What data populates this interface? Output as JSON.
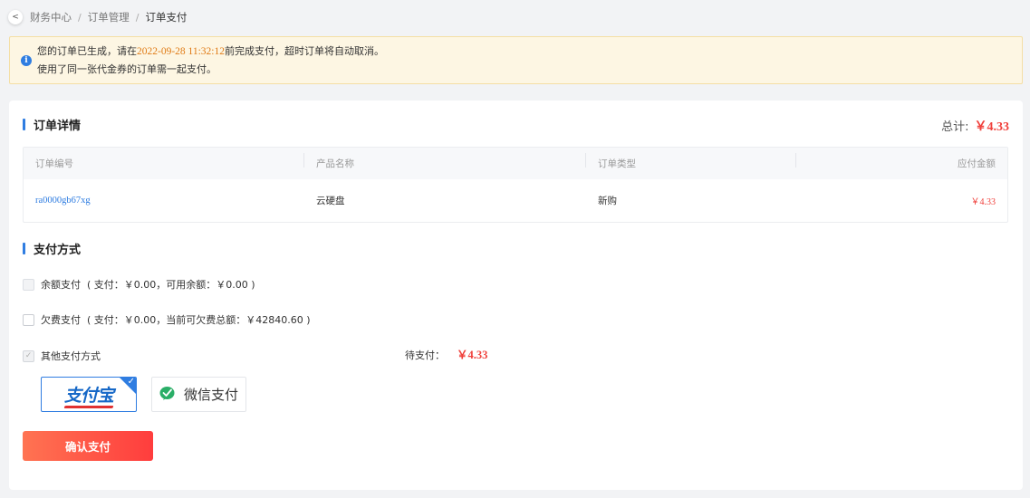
{
  "breadcrumb": {
    "back_label": "<",
    "items": [
      "财务中心",
      "订单管理"
    ],
    "separator": "/",
    "current": "订单支付"
  },
  "notice": {
    "info_symbol": "i",
    "line1_prefix": "您的订单已生成，请在",
    "deadline": "2022-09-28 11:32:12",
    "line1_suffix": "前完成支付，超时订单将自动取消。",
    "line2": "使用了同一张代金券的订单需一起支付。"
  },
  "order_section": {
    "title": "订单详情",
    "total_label": "总计:",
    "total_amount": "￥4.33",
    "columns": [
      "订单编号",
      "产品名称",
      "订单类型",
      "应付金额"
    ],
    "rows": [
      {
        "order_no": "ra0000gb67xg",
        "product": "云硬盘",
        "type": "新购",
        "amount": "￥4.33"
      }
    ]
  },
  "payment_section": {
    "title": "支付方式",
    "balance": {
      "label": "余额支付",
      "detail": "( 支付：￥0.00，可用余额：￥0.00 )",
      "checked": false,
      "disabled": true
    },
    "arrears": {
      "label": "欠费支付",
      "detail": "( 支付：￥0.00，当前可欠费总额：￥42840.60 )",
      "checked": false,
      "disabled": false
    },
    "other": {
      "label": "其他支付方式",
      "checked": true,
      "check_mark": "✓"
    },
    "pending_label": "待支付：",
    "pending_amount": "￥4.33",
    "methods": {
      "alipay": {
        "logo_text": "支付宝",
        "selected": true,
        "check_mark": "✓"
      },
      "wechat": {
        "label": "微信支付",
        "selected": false
      }
    },
    "confirm_label": "确认支付"
  },
  "colors": {
    "accent_blue": "#2f7de1",
    "price_red": "#f0413c",
    "deadline_orange": "#e07b16",
    "notice_bg": "#fdf6e3",
    "wechat_green": "#2aae67"
  }
}
